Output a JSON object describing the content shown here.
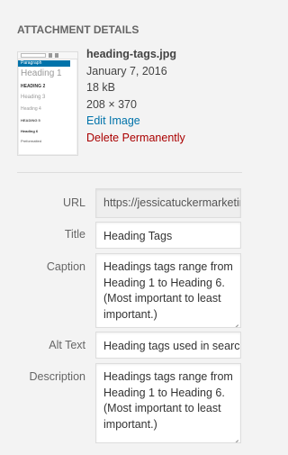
{
  "panel": {
    "heading": "ATTACHMENT DETAILS"
  },
  "thumbnail": {
    "dropdown_label": "Paragraph",
    "options": [
      "Paragraph",
      "Heading 1",
      "HEADING 2",
      "Heading 3",
      "Heading 4",
      "HEADING 5",
      "Heading 6",
      "Preformatted"
    ]
  },
  "file": {
    "name": "heading-tags.jpg",
    "date": "January 7, 2016",
    "size": "18 kB",
    "dimensions": "208 × 370",
    "edit_link": "Edit Image",
    "delete_link": "Delete Permanently"
  },
  "fields": {
    "url": {
      "label": "URL",
      "value": "https://jessicatuckermarketing.com"
    },
    "title": {
      "label": "Title",
      "value": "Heading Tags"
    },
    "caption": {
      "label": "Caption",
      "value": "Headings tags range from Heading 1 to Heading 6. (Most important to least important.)"
    },
    "alt": {
      "label": "Alt Text",
      "value": "Heading tags used in search"
    },
    "description": {
      "label": "Description",
      "value": "Headings tags range from Heading 1 to Heading 6. (Most important to least important.)"
    }
  },
  "colors": {
    "link": "#0073aa",
    "delete": "#aa0000",
    "background": "#f3f3f3"
  }
}
